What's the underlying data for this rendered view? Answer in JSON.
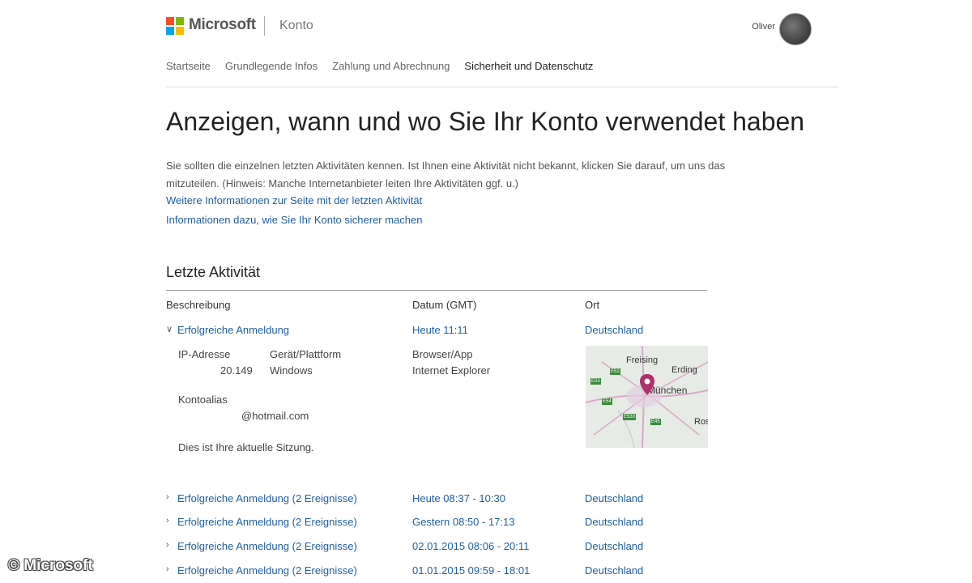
{
  "header": {
    "brand": "Microsoft",
    "section": "Konto",
    "user_name": "Oliver"
  },
  "nav": {
    "items": [
      {
        "label": "Startseite"
      },
      {
        "label": "Grundlegende Infos"
      },
      {
        "label": "Zahlung und Abrechnung"
      },
      {
        "label": "Sicherheit und Datenschutz"
      }
    ]
  },
  "main": {
    "title": "Anzeigen, wann und wo Sie Ihr Konto verwendet haben",
    "intro": "Sie sollten die einzelnen letzten Aktivitäten kennen. Ist Ihnen eine Aktivität nicht bekannt, klicken Sie darauf, um uns das mitzuteilen. (Hinweis: Manche Internetanbieter leiten Ihre Aktivitäten ggf. u.)",
    "link1": "Weitere Informationen zur Seite mit der letzten Aktivität",
    "link2": "Informationen dazu, wie Sie Ihr Konto sicherer machen"
  },
  "activity": {
    "heading": "Letzte Aktivität",
    "columns": {
      "description": "Beschreibung",
      "date": "Datum (GMT)",
      "location": "Ort"
    },
    "expanded": {
      "description": "Erfolgreiche Anmeldung",
      "date": "Heute 11:11",
      "location": "Deutschland",
      "ip_label": "IP-Adresse",
      "ip_value": "20.149",
      "device_label": "Gerät/Plattform",
      "device_value": "Windows",
      "browser_label": "Browser/App",
      "browser_value": "Internet Explorer",
      "alias_label": "Kontoalias",
      "alias_value": "@hotmail.com",
      "session_note": "Dies ist Ihre aktuelle Sitzung.",
      "map": {
        "cities": [
          "Freising",
          "Erding",
          "München",
          "Rose"
        ],
        "highways": [
          "E52",
          "E53",
          "E45",
          "E54",
          "E533"
        ]
      }
    },
    "rows": [
      {
        "description": "Erfolgreiche Anmeldung (2 Ereignisse)",
        "date": "Heute 08:37 - 10:30",
        "location": "Deutschland"
      },
      {
        "description": "Erfolgreiche Anmeldung (2 Ereignisse)",
        "date": "Gestern 08:50 - 17:13",
        "location": "Deutschland"
      },
      {
        "description": "Erfolgreiche Anmeldung (2 Ereignisse)",
        "date": "02.01.2015 08:06 - 20:11",
        "location": "Deutschland"
      },
      {
        "description": "Erfolgreiche Anmeldung (2 Ereignisse)",
        "date": "01.01.2015 09:59 - 18:01",
        "location": "Deutschland"
      }
    ]
  },
  "watermark": "© Microsoft",
  "colors": {
    "link": "#1f5f9e",
    "logo_red": "#f25022",
    "logo_green": "#7fba00",
    "logo_blue": "#00a4ef",
    "logo_yellow": "#ffb900",
    "map_pin": "#b0306a"
  }
}
